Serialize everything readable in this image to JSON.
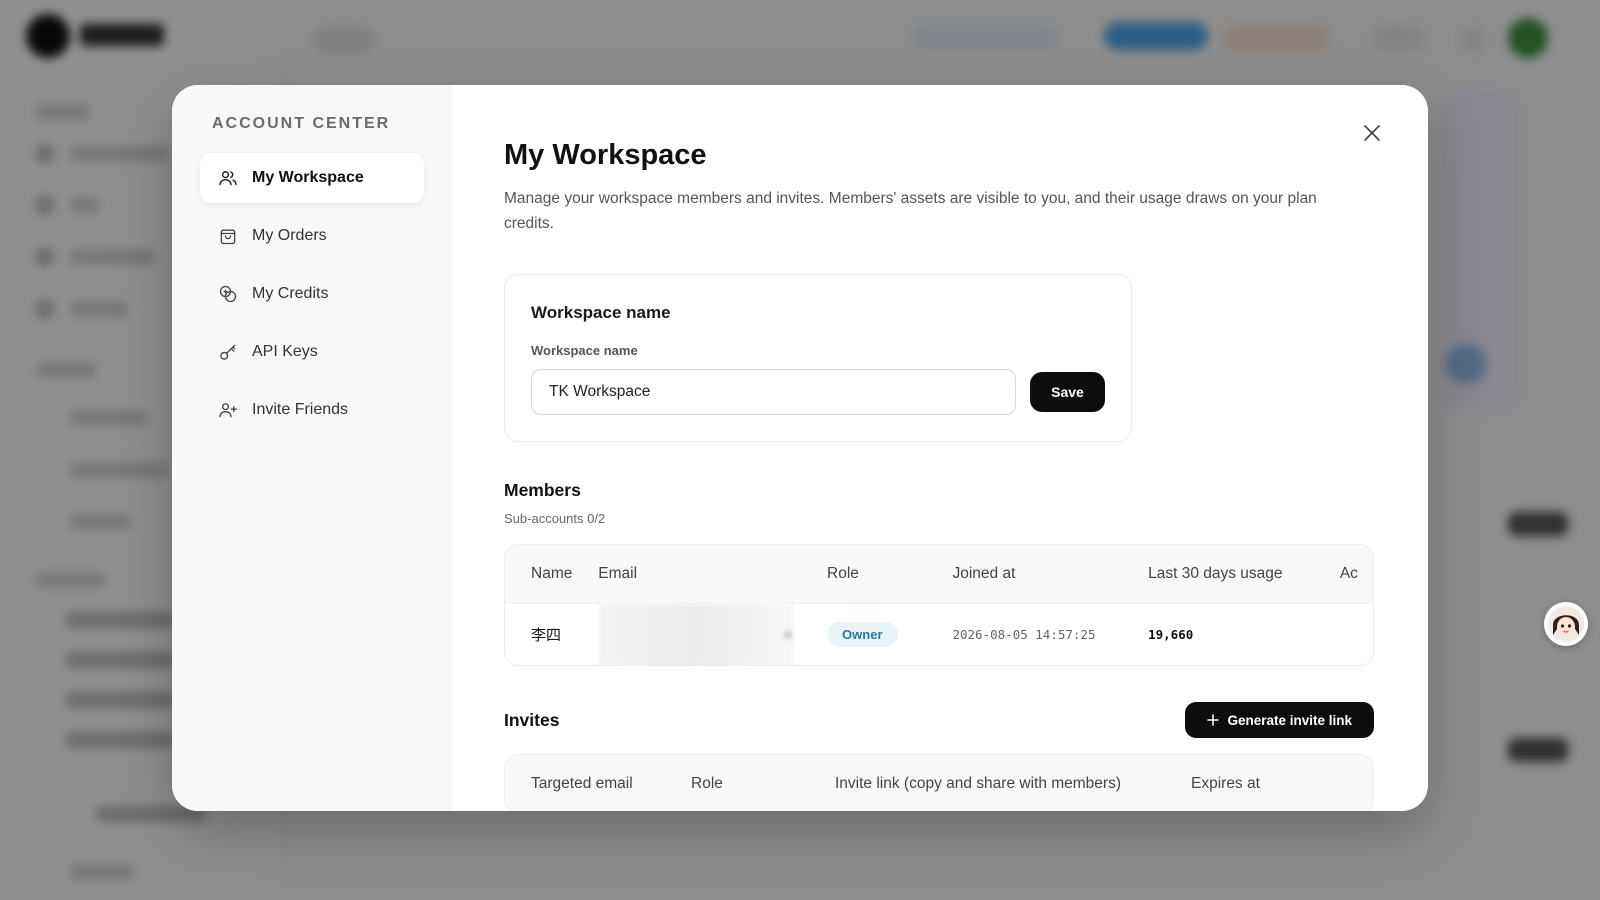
{
  "modal": {
    "sidebar_title": "ACCOUNT CENTER",
    "nav": [
      {
        "label": "My Workspace",
        "icon": "users-icon",
        "active": true
      },
      {
        "label": "My Orders",
        "icon": "bag-icon",
        "active": false
      },
      {
        "label": "My Credits",
        "icon": "coins-icon",
        "active": false
      },
      {
        "label": "API Keys",
        "icon": "key-icon",
        "active": false
      },
      {
        "label": "Invite Friends",
        "icon": "user-plus-icon",
        "active": false
      }
    ],
    "title": "My Workspace",
    "description": "Manage your workspace members and invites. Members' assets are visible to you, and their usage draws on your plan credits."
  },
  "workspace": {
    "card_title": "Workspace name",
    "field_label": "Workspace name",
    "value": "TK Workspace",
    "save_label": "Save"
  },
  "members": {
    "title": "Members",
    "subtitle": "Sub-accounts 0/2",
    "columns": [
      "Name",
      "Email",
      "Role",
      "Joined at",
      "Last 30 days usage",
      "Ac"
    ],
    "rows": [
      {
        "name": "李四",
        "email_tail": "n",
        "role": "Owner",
        "joined": "2026-08-05 14:57:25",
        "usage": "19,660"
      }
    ]
  },
  "invites": {
    "title": "Invites",
    "generate_label": "Generate invite link",
    "columns": [
      "Targeted email",
      "Role",
      "Invite link (copy and share with members)",
      "Expires at"
    ]
  },
  "colors": {
    "accent": "#0d0d0d",
    "owner_badge_bg": "#e8f4f8",
    "owner_badge_text": "#2a7b9a"
  }
}
